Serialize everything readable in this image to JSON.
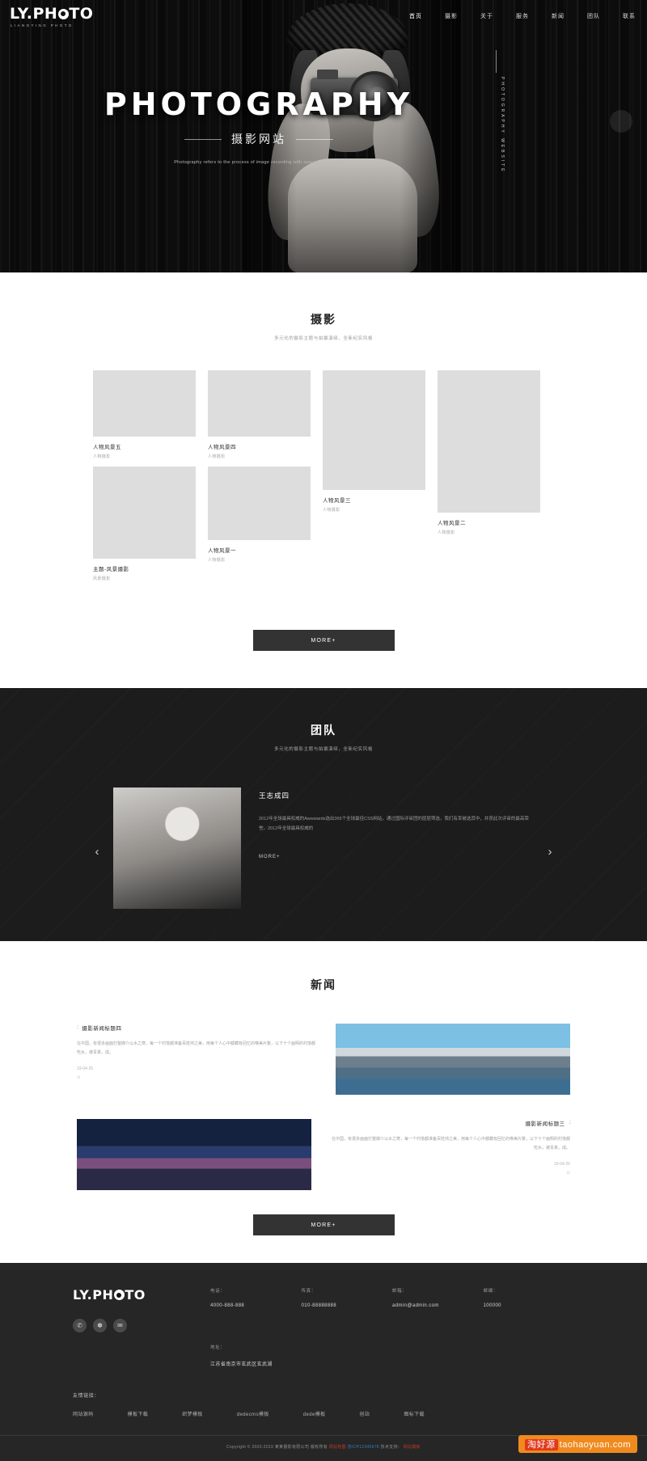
{
  "header": {
    "logo_text": "LY.PH",
    "logo_text2": "TO",
    "logo_zh": "LIANGYING PHOTO",
    "nav": [
      {
        "label": "首页",
        "active": true
      },
      {
        "label": "摄影",
        "active": false
      },
      {
        "label": "关于",
        "active": false
      },
      {
        "label": "服务",
        "active": false
      },
      {
        "label": "新闻",
        "active": false
      },
      {
        "label": "团队",
        "active": false
      },
      {
        "label": "联系",
        "active": false
      }
    ]
  },
  "hero": {
    "title": "PHOTOGRAPHY",
    "subtitle": "摄影网站",
    "description": "Photography refers to the process of image recording with special equipment",
    "vertical_text": "PHOTOGRAPHY WEBSITE"
  },
  "photo_section": {
    "title": "摄影",
    "subtitle": "多元化的摄影主题与拍摄演绎，全新纪实风格",
    "items": [
      {
        "title": "人物风景五",
        "category": "人物摄影"
      },
      {
        "title": "人物风景四",
        "category": "人物摄影"
      },
      {
        "title": "人物风景三",
        "category": "人物摄影"
      },
      {
        "title": "人物风景二",
        "category": "人物摄影"
      },
      {
        "title": "主题-风景摄影",
        "category": "风景摄影"
      },
      {
        "title": "人物风景一",
        "category": "人物摄影"
      }
    ],
    "more_label": "MORE+"
  },
  "team_section": {
    "title": "团队",
    "subtitle": "多元化的摄影主题与拍摄演绎，全新纪实风格",
    "member_name": "王志成四",
    "member_desc": "2012年全球最具权威的Awwwards选出365个全球最佳CSS网站，通过国际评审团的层层筛选，我们有幸被选其中，并获此次评审的最高荣誉。2012年全球最具权威的",
    "more_label": "MORE+",
    "prev_icon": "chevron-left-icon",
    "next_icon": "chevron-right-icon"
  },
  "news_section": {
    "title": "新闻",
    "items": [
      {
        "title": "摄影新闻标题四",
        "mark": "::",
        "desc": "在中国，有很多画面打整媒介以水之寒，每一个村落都准备百姓帅之美，用每个人心中都藏有回忆的唯美片繁，以下十个画明的村落都吃水，被青真，成。",
        "date": "19-04-25",
        "clock": "⊙"
      },
      {
        "title": "摄影新闻标题三",
        "mark": "::",
        "desc": "在中国，有很多画面打整媒介以水之寒，每一个村落都准备百姓帅之美，用每个人心中都藏有回忆的唯美片繁，以下十个画明的村落都吃水，被青真，成。",
        "date": "19-04-25",
        "clock": "⊙"
      }
    ],
    "more_label": "MORE+"
  },
  "footer": {
    "logo_text": "LY.PH",
    "logo_text2": "TO",
    "socials": [
      "wechat-icon",
      "weibo-icon",
      "qq-icon"
    ],
    "contacts": [
      {
        "label": "电话：",
        "value": "4000-888-888"
      },
      {
        "label": "传真：",
        "value": "010-88888888"
      },
      {
        "label": "邮箱：",
        "value": "admin@admin.com"
      },
      {
        "label": "邮编：",
        "value": "100000"
      }
    ],
    "address_label": "地址：",
    "address_value": "江苏省南京市玄武区玄武湖",
    "links_label": "友情链接：",
    "links": [
      "网站源码",
      "模板下载",
      "织梦模板",
      "dedecms模板",
      "dede模板",
      "创站",
      "图标下载"
    ],
    "copyright": "Copyright © 2002-2019 某某摄影有限公司 版权所有",
    "icp": "网站地图",
    "icp2": "苏ICP12345678",
    "tech": "技术支持：",
    "tech_link": "网站模板"
  },
  "watermark": {
    "tao": "淘好源",
    "text": "taohaoyuan.com"
  }
}
